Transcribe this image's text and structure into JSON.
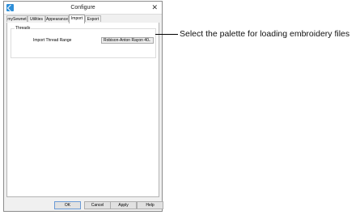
{
  "window": {
    "title": "Configure",
    "close_glyph": "✕"
  },
  "tabs": [
    {
      "label": "mySewnet"
    },
    {
      "label": "Utilities"
    },
    {
      "label": "Appearance"
    },
    {
      "label": "Import",
      "active": true
    },
    {
      "label": "Export"
    }
  ],
  "import_tab": {
    "group_label": "Threads",
    "thread_range_label": "Import Thread Range",
    "thread_range_value": "Robison-Anton Rayon 40"
  },
  "buttons": {
    "ok": "OK",
    "cancel": "Cancel",
    "apply": "Apply",
    "help": "Help"
  },
  "callout": "Select the palette for loading embroidery files",
  "colors": {
    "app_icon": "#2f8fd8",
    "dialog_bg": "#f0f0f0",
    "default_button_border": "#6b9bd6"
  },
  "icons": {
    "app": "app-icon",
    "close": "close-icon",
    "dropdown": "chevron-down-icon"
  }
}
